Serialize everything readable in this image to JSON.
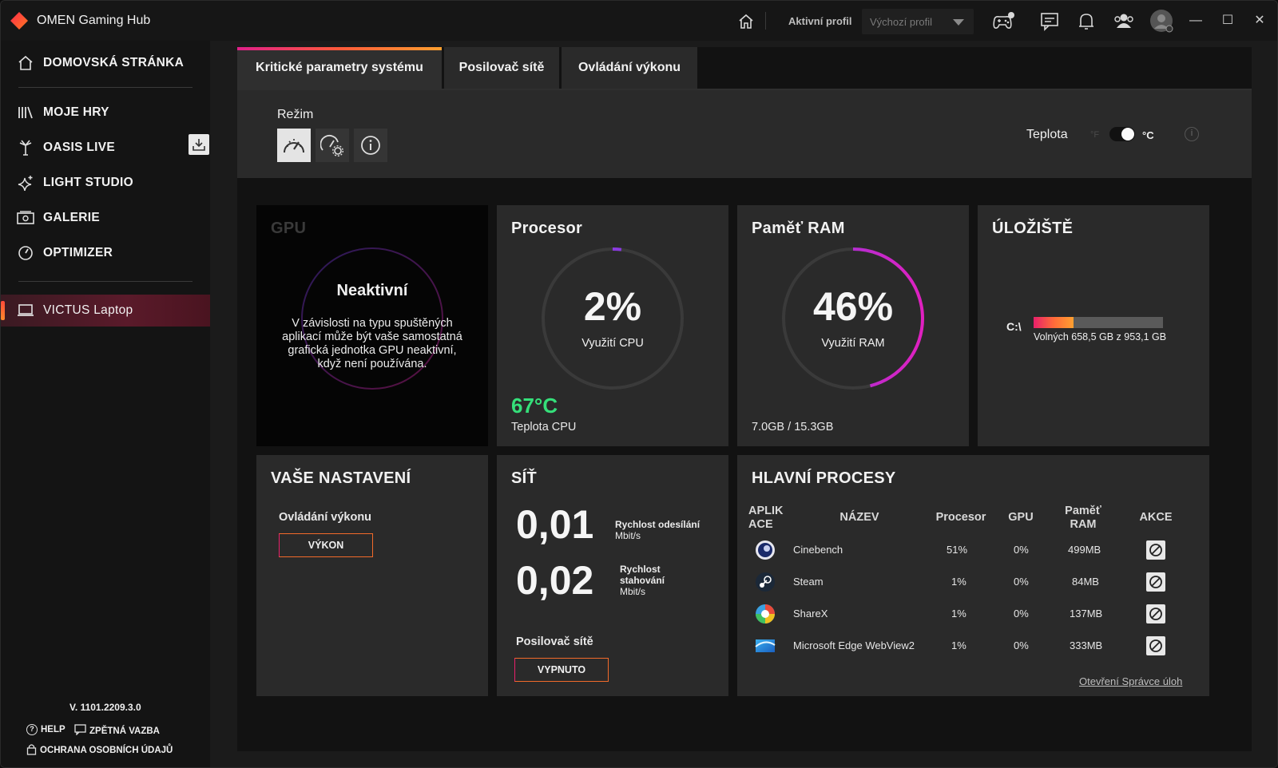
{
  "app": {
    "title": "OMEN Gaming Hub"
  },
  "titlebar": {
    "profile_label": "Aktivní profil",
    "profile_value": "Výchozí profil"
  },
  "sidebar": {
    "items": [
      {
        "label": "DOMOVSKÁ STRÁNKA",
        "icon": "home-icon"
      },
      {
        "label": "MOJE HRY",
        "icon": "library-icon"
      },
      {
        "label": "OASIS LIVE",
        "icon": "oasis-icon"
      },
      {
        "label": "LIGHT STUDIO",
        "icon": "sparkle-icon"
      },
      {
        "label": "GALERIE",
        "icon": "gallery-icon"
      },
      {
        "label": "OPTIMIZER",
        "icon": "optimizer-icon"
      },
      {
        "label": "VICTUS Laptop",
        "icon": "laptop-icon"
      }
    ],
    "version": "V. 1101.2209.3.0",
    "help": "HELP",
    "feedback": "ZPĚTNÁ VAZBA",
    "privacy": "OCHRANA OSOBNÍCH ÚDAJŮ"
  },
  "tabs": [
    {
      "label": "Kritické parametry systému"
    },
    {
      "label": "Posilovač sítě"
    },
    {
      "label": "Ovládání výkonu"
    }
  ],
  "mode": {
    "title": "Režim",
    "temp_label": "Teplota",
    "unit_f": "°F",
    "unit_c": "°C"
  },
  "gpu": {
    "title": "GPU",
    "state": "Neaktivní",
    "description": "V závislosti na typu spuštěných aplikací může být vaše samostatná grafická jednotka GPU neaktivní, když není používána."
  },
  "cpu": {
    "title": "Procesor",
    "usage": "2%",
    "usage_fraction": 0.02,
    "usage_label": "Využití CPU",
    "temp": "67°C",
    "temp_label": "Teplota CPU"
  },
  "ram": {
    "title": "Paměť RAM",
    "usage": "46%",
    "usage_fraction": 0.46,
    "usage_label": "Využití RAM",
    "used": "7.0GB / 15.3GB"
  },
  "storage": {
    "title": "ÚLOŽIŠTĚ",
    "drive": "C:\\",
    "used_fraction": 0.31,
    "free_text": "Volných 658,5 GB z 953,1 GB"
  },
  "settings": {
    "title": "VAŠE NASTAVENÍ",
    "sub": "Ovládání výkonu",
    "button": "VÝKON"
  },
  "network": {
    "title": "SÍŤ",
    "upload_value": "0,01",
    "upload_label": "Rychlost odesílání",
    "upload_unit": "Mbit/s",
    "download_value": "0,02",
    "download_label_1": "Rychlost",
    "download_label_2": "stahování",
    "download_unit": "Mbit/s",
    "boost_label": "Posilovač sítě",
    "boost_button": "VYPNUTO"
  },
  "processes": {
    "title": "HLAVNÍ PROCESY",
    "headers": {
      "app_1": "APLIK",
      "app_2": "ACE",
      "name": "NÁZEV",
      "cpu": "Procesor",
      "gpu": "GPU",
      "ram_1": "Paměť",
      "ram_2": "RAM",
      "action": "AKCE"
    },
    "rows": [
      {
        "name": "Cinebench",
        "cpu": "51%",
        "gpu": "0%",
        "ram": "499MB",
        "icon": "cinebench-icon"
      },
      {
        "name": "Steam",
        "cpu": "1%",
        "gpu": "0%",
        "ram": "84MB",
        "icon": "steam-icon"
      },
      {
        "name": "ShareX",
        "cpu": "1%",
        "gpu": "0%",
        "ram": "137MB",
        "icon": "sharex-icon"
      },
      {
        "name": "Microsoft Edge WebView2",
        "cpu": "1%",
        "gpu": "0%",
        "ram": "333MB",
        "icon": "edge-webview-icon"
      }
    ],
    "task_manager_link": "Otevření Správce úloh"
  },
  "colors": {
    "accent_gradient_start": "#e0208a",
    "accent_gradient_end": "#ffa030",
    "cpu_temp": "#35e07a",
    "ram_ring": "#c020e0"
  }
}
